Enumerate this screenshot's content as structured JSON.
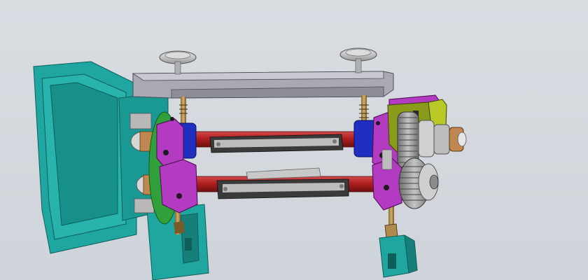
{
  "viewport": {
    "background": "#d3d8de",
    "render_mode": "shaded-with-edges"
  },
  "model": {
    "components": [
      {
        "name": "base-frame",
        "color": "#1fa6a0"
      },
      {
        "name": "top-crossbar",
        "color": "#a9a9b4"
      },
      {
        "name": "handwheel",
        "count": 2,
        "color": "#c8c8c8"
      },
      {
        "name": "lead-screw",
        "count": 4,
        "color": "#b08a4a"
      },
      {
        "name": "bearing-block",
        "count": 4,
        "color": "#b23bc2"
      },
      {
        "name": "bearing-housing",
        "count": 3,
        "color": "#1f2fbf"
      },
      {
        "name": "roller-shaft",
        "count": 2,
        "color": "#b01f1f"
      },
      {
        "name": "slide-rail",
        "count": 2,
        "color": "#3a3a3a"
      },
      {
        "name": "drive-gear",
        "count": 2,
        "color": "#8c8c8c"
      },
      {
        "name": "bracket-plate",
        "color": "#8a9a1a"
      },
      {
        "name": "support-foot",
        "color": "#1fa6a0"
      }
    ]
  }
}
